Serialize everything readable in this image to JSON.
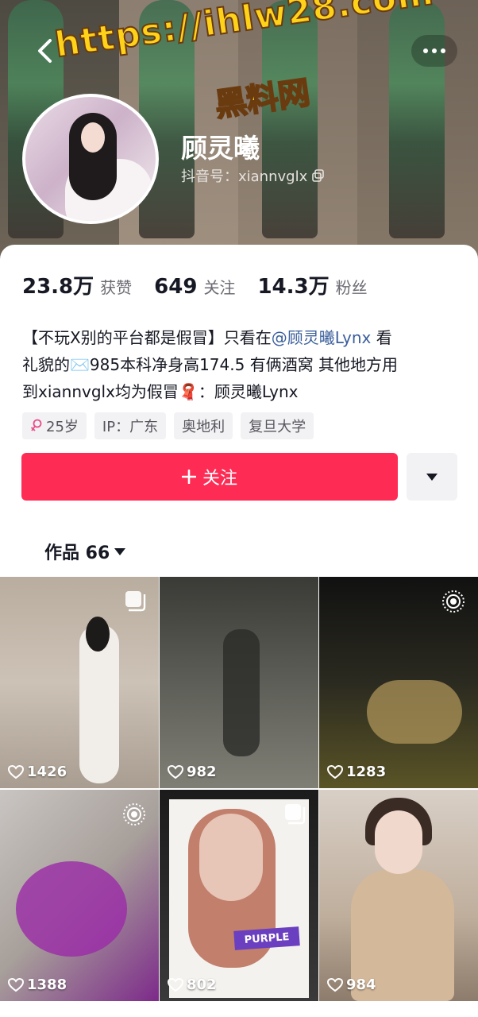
{
  "header": {
    "watermark_url": "https://ihlw28.com",
    "watermark_site": "黑料网",
    "name": "顾灵曦",
    "douyin_id": "抖音号：xiannvglx"
  },
  "stats": [
    {
      "value": "23.8万",
      "label": "获赞"
    },
    {
      "value": "649",
      "label": "关注"
    },
    {
      "value": "14.3万",
      "label": "粉丝"
    }
  ],
  "bio": {
    "line1_prefix": "【不玩X别的平台都是假冒】只看在",
    "mention": "@顾灵曦Lynx",
    "line1_suffix": " 看",
    "line2": "礼貌的✉️985本科净身高174.5 有俩酒窝 其他地方用",
    "line3": "到xiannvglx均为假冒🧣：顾灵曦Lynx"
  },
  "tags": [
    {
      "icon": "female-icon",
      "label": "25岁"
    },
    {
      "label": "IP：广东"
    },
    {
      "label": "奥地利"
    },
    {
      "label": "复旦大学"
    }
  ],
  "actions": {
    "follow_label": "关注",
    "follow_color": "#fe2c55"
  },
  "works_tab": {
    "label": "作品 66"
  },
  "videos": [
    {
      "likes": "1426",
      "badge": "multi-image-icon"
    },
    {
      "likes": "982",
      "badge": ""
    },
    {
      "likes": "1283",
      "badge": "live-photo-icon"
    },
    {
      "likes": "1388",
      "badge": "live-photo-icon"
    },
    {
      "likes": "802",
      "badge": "multi-image-icon",
      "sticker": "PURPLE"
    },
    {
      "likes": "984",
      "badge": ""
    }
  ]
}
